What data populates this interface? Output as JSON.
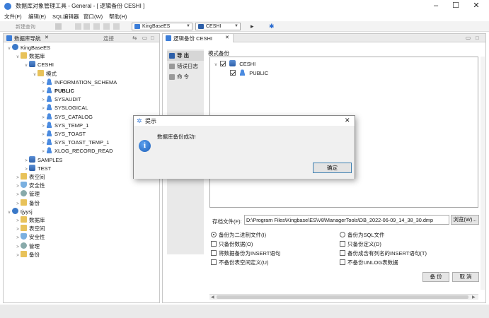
{
  "window": {
    "title": "数据库对象管理工具 - General - [ 逻辑备份 CESHI ]",
    "min": "–",
    "max": "☐",
    "close": "✕"
  },
  "menu": [
    "文件(F)",
    "编辑(E)",
    "SQL编辑器",
    "窗口(W)",
    "帮助(H)"
  ],
  "toolbar": {
    "new_query": "新建查询",
    "server_select": "KingBaseES",
    "db_select": "CESHI"
  },
  "left_panel": {
    "tab": "数据库导航",
    "connect": "连接"
  },
  "tree": [
    {
      "label": "KingBaseES",
      "level": 0,
      "icon": "server-icon",
      "twisty": "v"
    },
    {
      "label": "数据库",
      "level": 1,
      "icon": "folder-icon",
      "twisty": "v"
    },
    {
      "label": "CESHI",
      "level": 2,
      "icon": "database-icon",
      "twisty": "v"
    },
    {
      "label": "模式",
      "level": 3,
      "icon": "folder-icon",
      "twisty": "v"
    },
    {
      "label": "INFORMATION_SCHEMA",
      "level": 4,
      "icon": "user-icon",
      "twisty": ">"
    },
    {
      "label": "PUBLIC",
      "level": 4,
      "icon": "user-icon",
      "twisty": ">",
      "bold": true
    },
    {
      "label": "SYSAUDIT",
      "level": 4,
      "icon": "user-icon",
      "twisty": ">"
    },
    {
      "label": "SYSLOGICAL",
      "level": 4,
      "icon": "user-icon",
      "twisty": ">"
    },
    {
      "label": "SYS_CATALOG",
      "level": 4,
      "icon": "user-icon",
      "twisty": ">"
    },
    {
      "label": "SYS_TEMP_1",
      "level": 4,
      "icon": "user-icon",
      "twisty": ">"
    },
    {
      "label": "SYS_TOAST",
      "level": 4,
      "icon": "user-icon",
      "twisty": ">"
    },
    {
      "label": "SYS_TOAST_TEMP_1",
      "level": 4,
      "icon": "user-icon",
      "twisty": ">"
    },
    {
      "label": "XLOG_RECORD_READ",
      "level": 4,
      "icon": "user-icon",
      "twisty": ">"
    },
    {
      "label": "SAMPLES",
      "level": 2,
      "icon": "database-icon",
      "twisty": ">"
    },
    {
      "label": "TEST",
      "level": 2,
      "icon": "database-icon",
      "twisty": ">"
    },
    {
      "label": "表空间",
      "level": 1,
      "icon": "folder-icon",
      "twisty": ">"
    },
    {
      "label": "安全性",
      "level": 1,
      "icon": "shield-icon",
      "twisty": ">"
    },
    {
      "label": "管理",
      "level": 1,
      "icon": "gear-icon",
      "twisty": ">"
    },
    {
      "label": "备份",
      "level": 1,
      "icon": "folder-icon",
      "twisty": ">"
    },
    {
      "label": "tjyysj",
      "level": 0,
      "icon": "server-icon",
      "twisty": "v"
    },
    {
      "label": "数据库",
      "level": 1,
      "icon": "folder-icon",
      "twisty": ">"
    },
    {
      "label": "表空间",
      "level": 1,
      "icon": "folder-icon",
      "twisty": ">"
    },
    {
      "label": "安全性",
      "level": 1,
      "icon": "shield-icon",
      "twisty": ">"
    },
    {
      "label": "管理",
      "level": 1,
      "icon": "gear-icon",
      "twisty": ">"
    },
    {
      "label": "备份",
      "level": 1,
      "icon": "folder-icon",
      "twisty": ">"
    }
  ],
  "right_panel": {
    "tab": "逻辑备份 CESHI"
  },
  "side_nav": [
    "导 出",
    "错误日志",
    "命 令"
  ],
  "backup": {
    "mode_label": "模式备份",
    "schema_root": "CESHI",
    "schema_child": "PUBLIC",
    "file_label": "存档文件(F):",
    "file_path": "D:\\Program Files\\Kingbase\\ES\\V8\\ManagerTools\\DB_2022-06-09_14_38_30.dmp",
    "browse": "浏览(W)...",
    "options": [
      {
        "label": "备份为二进制文件(I)",
        "type": "radio",
        "on": true
      },
      {
        "label": "备份为SQL文件",
        "type": "radio",
        "on": false
      },
      {
        "label": "只备份数据(O)",
        "type": "check",
        "on": false
      },
      {
        "label": "只备份定义(D)",
        "type": "check",
        "on": false
      },
      {
        "label": "将数据备份为INSERT语句",
        "type": "check",
        "on": false
      },
      {
        "label": "备份成含有列名的INSERT语句(T)",
        "type": "check",
        "on": false
      },
      {
        "label": "不备份表空间定义(U)",
        "type": "check",
        "on": false
      },
      {
        "label": "不备份UNLOG表数据",
        "type": "check",
        "on": false
      }
    ],
    "backup_button": "备 份",
    "cancel_button": "取 消"
  },
  "dialog": {
    "title": "提示",
    "message": "数据库备份成功!",
    "ok": "确定",
    "close": "✕"
  }
}
